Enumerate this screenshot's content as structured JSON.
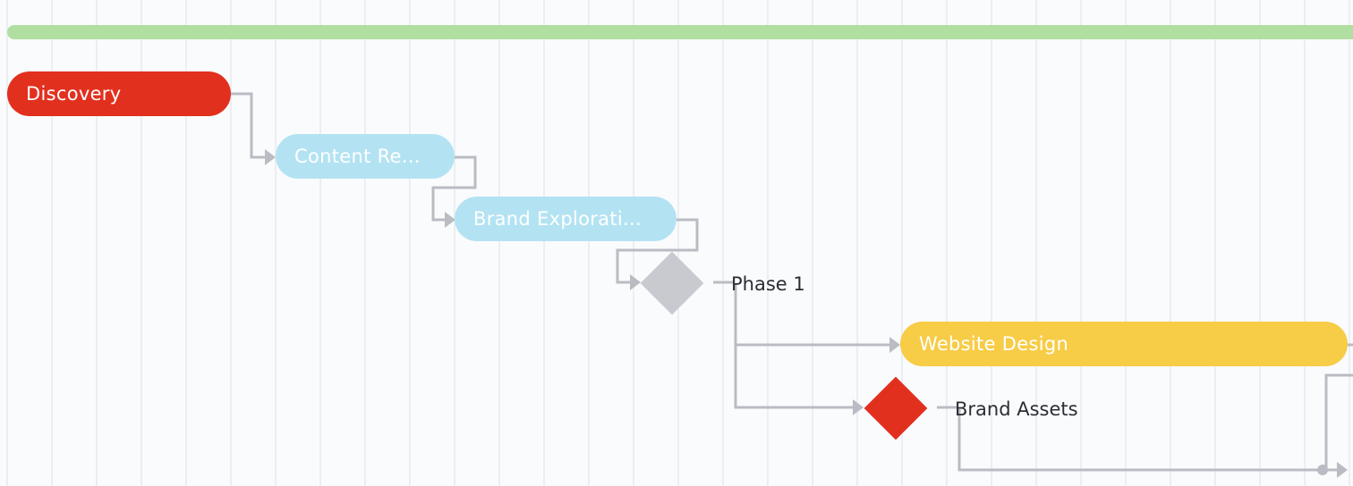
{
  "colors": {
    "summary": "#b1dea1",
    "discovery": "#e2301f",
    "light_blue": "#b3e3f3",
    "yellow": "#f7cc47",
    "milestone_gray": "#c9cacf",
    "milestone_red": "#e2301f",
    "connector": "#b9bcc2"
  },
  "gantt": {
    "summary_bar": {
      "label": ""
    },
    "tasks": [
      {
        "id": "discovery",
        "label": "Discovery"
      },
      {
        "id": "content-review",
        "label": "Content Re..."
      },
      {
        "id": "brand-exploration",
        "label": "Brand Explorati..."
      },
      {
        "id": "website-design",
        "label": "Website Design"
      }
    ],
    "milestones": [
      {
        "id": "phase-1",
        "label": "Phase 1"
      },
      {
        "id": "brand-assets",
        "label": "Brand Assets"
      }
    ]
  }
}
